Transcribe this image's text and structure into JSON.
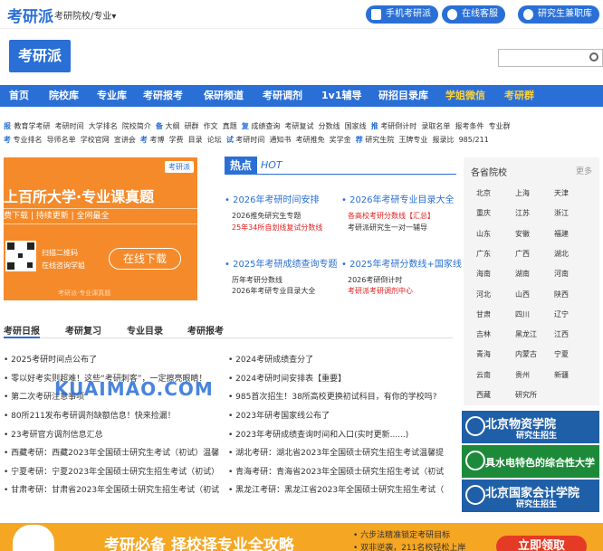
{
  "topbar": {
    "logo": "考研派",
    "selector": "考研院校/专业▾",
    "buttons": [
      "手机考研派",
      "在线客服",
      "研究生兼职库"
    ]
  },
  "header": {
    "logo": "考研派",
    "search_placeholder": ""
  },
  "nav": [
    "首页",
    "院校库",
    "专业库",
    "考研报考",
    "保研频道",
    "考研调剂",
    "1v1辅导",
    "研招目录库",
    "学姐微信",
    "考研群"
  ],
  "quick_links": {
    "row1": [
      {
        "tag": "报",
        "items": [
          "教育学考研",
          "考研时间",
          "大学排名",
          "院校简介"
        ]
      },
      {
        "tag": "备",
        "items": [
          "大纲",
          "研群",
          "作文",
          "真题"
        ]
      },
      {
        "tag": "复",
        "items": [
          "成绩查询",
          "考研复试",
          "分数线",
          "国家线"
        ]
      },
      {
        "tag": "推",
        "items": [
          "考研倒计时",
          "录取名单",
          "报考条件",
          "专业群"
        ]
      }
    ],
    "row2": [
      {
        "tag": "考",
        "items": [
          "专业排名",
          "导师名单",
          "学校官网",
          "宣讲会"
        ]
      },
      {
        "tag": "考",
        "items": [
          "考博",
          "学费",
          "目录",
          "论坛"
        ]
      },
      {
        "tag": "试",
        "items": [
          "考研时间",
          "通知书",
          "考研推免",
          "奖学金"
        ]
      },
      {
        "tag": "荐",
        "items": [
          "研究生院",
          "王牌专业",
          "报录比",
          "985/211"
        ]
      }
    ]
  },
  "banner": {
    "brand": "考研派",
    "headline": "上百所大学·专业课真题",
    "subline": "费下载  |  持续更新  |  全网最全",
    "note1": "扫描二维码",
    "note2": "在线咨询学姐",
    "download": "在线下载",
    "small": "考研派·专业课真题"
  },
  "hot": {
    "title": "热点",
    "title_en": "HOT",
    "blocks": [
      {
        "head": "2026年考研时间安排",
        "lines": [
          {
            "text": "2026推免研究生专题",
            "red": false
          },
          {
            "text": "25年34所自划线复试分数线",
            "red": true
          }
        ]
      },
      {
        "head": "2026年考研专业目录大全",
        "lines": [
          {
            "text": "各高校考研分数线【汇总】",
            "red": true
          },
          {
            "text": "考研派研究生一对一辅导",
            "red": false
          }
        ]
      },
      {
        "head": "2025年考研成绩查询专题",
        "lines": [
          {
            "text": "历年考研分数线",
            "red": false
          },
          {
            "text": "2026年考研专业目录大全",
            "red": false
          }
        ]
      },
      {
        "head": "2025年考研分数线+国家线",
        "lines": [
          {
            "text": "2026考研倒计时",
            "red": false
          },
          {
            "text": "考研派考研调剂中心",
            "red": true
          }
        ]
      }
    ]
  },
  "tabs": [
    "考研日报",
    "考研复习",
    "专业目录",
    "考研报考"
  ],
  "news_left": [
    "2025考研时间点公布了",
    "零以好考实则超难！这些“考研刺客”，一定擦亮眼睛！",
    "第二次考研注意事项",
    "80所211发布考研调剂缺额信息！快来捡漏！",
    "23考研官方调剂信息汇总",
    "西藏考研：西藏2023年全国硕士研究生考试（初试）温馨",
    "宁夏考研：宁夏2023年全国硕士研究生招生考试（初试）",
    "甘肃考研：甘肃省2023年全国硕士研究生招生考试（初试"
  ],
  "news_right": [
    "2024考研成绩查分了",
    "2024考研时间安排表【重要】",
    "985首次招生！38所高校更换初试科目，有你的学校吗?",
    "2023年研考国家线公布了",
    "2023年考研成绩查询时间和入口(实时更新......)",
    "湖北考研：湖北省2023年全国硕士研究生招生考试温馨提",
    "青海考研：青海省2023年全国硕士研究生招生考试（初试",
    "黑龙江考研：黑龙江省2023年全国硕士研究生招生考试（"
  ],
  "watermark": "KUAIMAO.COM",
  "side": {
    "title": "各省院校",
    "more": "更多",
    "provinces": [
      "北京",
      "上海",
      "天津",
      "重庆",
      "江苏",
      "浙江",
      "山东",
      "安徽",
      "福建",
      "广东",
      "广西",
      "湖北",
      "海南",
      "湖南",
      "河南",
      "河北",
      "山西",
      "陕西",
      "甘肃",
      "四川",
      "辽宁",
      "吉林",
      "黑龙江",
      "江西",
      "青海",
      "内蒙古",
      "宁夏",
      "云南",
      "贵州",
      "新疆",
      "西藏",
      "研究所"
    ]
  },
  "ads": [
    {
      "title": "北京物资学院",
      "sub": "研究生招生",
      "color": "#1f5fa8"
    },
    {
      "title": "具水电特色的综合性大学",
      "sub": "",
      "color": "#1d8a3a"
    },
    {
      "title": "北京国家会计学院",
      "sub": "研究生招生",
      "color": "#1f5fa8"
    }
  ],
  "bottom": {
    "headline": "考研必备 择校择专业全攻略",
    "points": [
      "六步法精准锁定考研目标",
      "双非逆袭，211名校轻松上岸"
    ],
    "button": "立即领取"
  }
}
